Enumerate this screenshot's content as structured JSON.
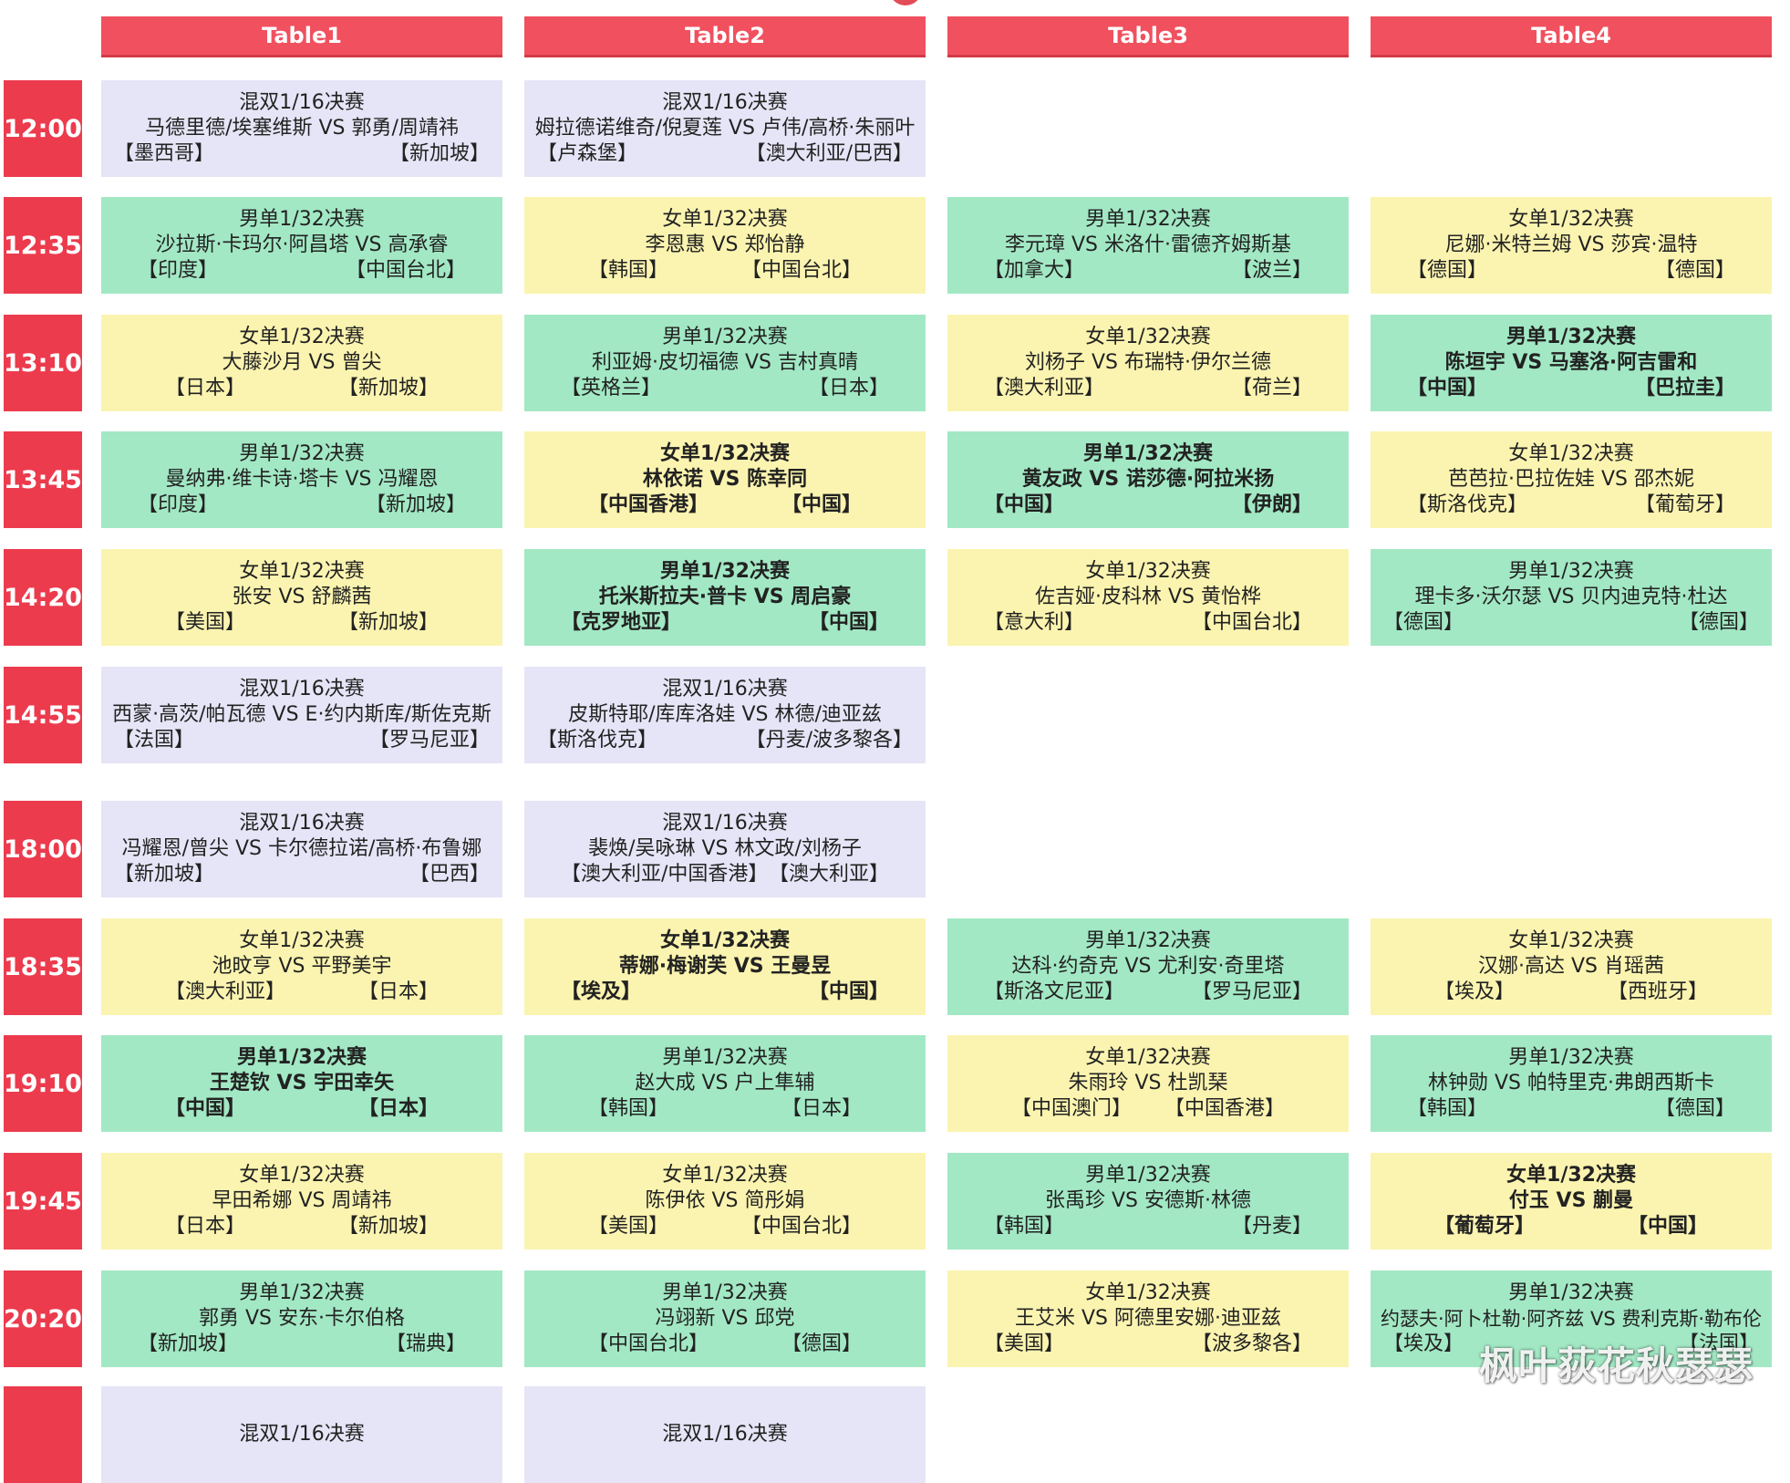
{
  "tables": [
    "Table1",
    "Table2",
    "Table3",
    "Table4"
  ],
  "rows": [
    {
      "time": "12:00",
      "cells": [
        {
          "type": "mx",
          "bold": false,
          "event": "混双1/16决赛",
          "players": "马德里德/埃塞维斯 VS 郭勇/周靖祎",
          "c1": "【墨西哥】",
          "c2": "【新加坡】"
        },
        {
          "type": "mx",
          "bold": false,
          "event": "混双1/16决赛",
          "players": "姆拉德诺维奇/倪夏莲 VS 卢伟/高桥·朱丽叶",
          "c1": "【卢森堡】",
          "c2": "【澳大利亚/巴西】"
        },
        null,
        null
      ]
    },
    {
      "time": "12:35",
      "cells": [
        {
          "type": "ms",
          "bold": false,
          "event": "男单1/32决赛",
          "players": "沙拉斯·卡玛尔·阿昌塔 VS 高承睿",
          "c1": "【印度】",
          "c2": "【中国台北】"
        },
        {
          "type": "ws",
          "bold": false,
          "event": "女单1/32决赛",
          "players": "李恩惠 VS 郑怡静",
          "c1": "【韩国】",
          "c2": "【中国台北】"
        },
        {
          "type": "ms",
          "bold": false,
          "event": "男单1/32决赛",
          "players": "李元璋 VS 米洛什·雷德齐姆斯基",
          "c1": "【加拿大】",
          "c2": "【波兰】"
        },
        {
          "type": "ws",
          "bold": false,
          "event": "女单1/32决赛",
          "players": "尼娜·米特兰姆 VS 莎宾·温特",
          "c1": "【德国】",
          "c2": "【德国】"
        }
      ]
    },
    {
      "time": "13:10",
      "cells": [
        {
          "type": "ws",
          "bold": false,
          "event": "女单1/32决赛",
          "players": "大藤沙月 VS 曾尖",
          "c1": "【日本】",
          "c2": "【新加坡】"
        },
        {
          "type": "ms",
          "bold": false,
          "event": "男单1/32决赛",
          "players": "利亚姆·皮切福德 VS 吉村真晴",
          "c1": "【英格兰】",
          "c2": "【日本】"
        },
        {
          "type": "ws",
          "bold": false,
          "event": "女单1/32决赛",
          "players": "刘杨子 VS 布瑞特·伊尔兰德",
          "c1": "【澳大利亚】",
          "c2": "【荷兰】"
        },
        {
          "type": "ms",
          "bold": true,
          "event": "男单1/32决赛",
          "players": "陈垣宇 VS 马塞洛·阿吉雷和",
          "c1": "【中国】",
          "c2": "【巴拉圭】"
        }
      ]
    },
    {
      "time": "13:45",
      "cells": [
        {
          "type": "ms",
          "bold": false,
          "event": "男单1/32决赛",
          "players": "曼纳弗·维卡诗·塔卡 VS 冯耀恩",
          "c1": "【印度】",
          "c2": "【新加坡】"
        },
        {
          "type": "ws",
          "bold": true,
          "event": "女单1/32决赛",
          "players": "林依诺 VS 陈幸同",
          "c1": "【中国香港】",
          "c2": "【中国】"
        },
        {
          "type": "ms",
          "bold": true,
          "event": "男单1/32决赛",
          "players": "黄友政 VS 诺莎德·阿拉米扬",
          "c1": "【中国】",
          "c2": "【伊朗】"
        },
        {
          "type": "ws",
          "bold": false,
          "event": "女单1/32决赛",
          "players": "芭芭拉·巴拉佐娃 VS 邵杰妮",
          "c1": "【斯洛伐克】",
          "c2": "【葡萄牙】"
        }
      ]
    },
    {
      "time": "14:20",
      "cells": [
        {
          "type": "ws",
          "bold": false,
          "event": "女单1/32决赛",
          "players": "张安 VS 舒麟茜",
          "c1": "【美国】",
          "c2": "【新加坡】"
        },
        {
          "type": "ms",
          "bold": true,
          "event": "男单1/32决赛",
          "players": "托米斯拉夫·普卡 VS 周启豪",
          "c1": "【克罗地亚】",
          "c2": "【中国】"
        },
        {
          "type": "ws",
          "bold": false,
          "event": "女单1/32决赛",
          "players": "佐吉娅·皮科林 VS 黄怡桦",
          "c1": "【意大利】",
          "c2": "【中国台北】"
        },
        {
          "type": "ms",
          "bold": false,
          "event": "男单1/32决赛",
          "players": "理卡多·沃尔瑟 VS 贝内迪克特·杜达",
          "c1": "【德国】",
          "c2": "【德国】"
        }
      ]
    },
    {
      "time": "14:55",
      "cells": [
        {
          "type": "mx",
          "bold": false,
          "event": "混双1/16决赛",
          "players": "西蒙·高茨/帕瓦德 VS E·约内斯库/斯佐克斯",
          "c1": "【法国】",
          "c2": "【罗马尼亚】"
        },
        {
          "type": "mx",
          "bold": false,
          "event": "混双1/16决赛",
          "players": "皮斯特耶/库库洛娃 VS 林德/迪亚兹",
          "c1": "【斯洛伐克】",
          "c2": "【丹麦/波多黎各】"
        },
        null,
        null
      ]
    },
    {
      "time": "18:00",
      "cells": [
        {
          "type": "mx",
          "bold": false,
          "event": "混双1/16决赛",
          "players": "冯耀恩/曾尖 VS 卡尔德拉诺/高桥·布鲁娜",
          "c1": "【新加坡】",
          "c2": "【巴西】"
        },
        {
          "type": "mx",
          "bold": false,
          "event": "混双1/16决赛",
          "players": "裴焕/吴咏琳 VS 林文政/刘杨子",
          "c1": "【澳大利亚/中国香港】",
          "c2": "【澳大利亚】"
        },
        null,
        null
      ]
    },
    {
      "time": "18:35",
      "cells": [
        {
          "type": "ws",
          "bold": false,
          "event": "女单1/32决赛",
          "players": "池旼亨 VS 平野美宇",
          "c1": "【澳大利亚】",
          "c2": "【日本】"
        },
        {
          "type": "ws",
          "bold": true,
          "event": "女单1/32决赛",
          "players": "蒂娜·梅谢芙 VS 王曼昱",
          "c1": "【埃及】",
          "c2": "【中国】"
        },
        {
          "type": "ms",
          "bold": false,
          "event": "男单1/32决赛",
          "players": "达科·约奇克 VS 尤利安·奇里塔",
          "c1": "【斯洛文尼亚】",
          "c2": "【罗马尼亚】"
        },
        {
          "type": "ws",
          "bold": false,
          "event": "女单1/32决赛",
          "players": "汉娜·高达 VS 肖瑶茜",
          "c1": "【埃及】",
          "c2": "【西班牙】"
        }
      ]
    },
    {
      "time": "19:10",
      "cells": [
        {
          "type": "ms",
          "bold": true,
          "event": "男单1/32决赛",
          "players": "王楚钦 VS 宇田幸矢",
          "c1": "【中国】",
          "c2": "【日本】"
        },
        {
          "type": "ms",
          "bold": false,
          "event": "男单1/32决赛",
          "players": "赵大成 VS 户上隼辅",
          "c1": "【韩国】",
          "c2": "【日本】"
        },
        {
          "type": "ws",
          "bold": false,
          "event": "女单1/32决赛",
          "players": "朱雨玲 VS 杜凯琹",
          "c1": "【中国澳门】",
          "c2": "【中国香港】"
        },
        {
          "type": "ms",
          "bold": false,
          "event": "男单1/32决赛",
          "players": "林钟勋 VS 帕特里克·弗朗西斯卡",
          "c1": "【韩国】",
          "c2": "【德国】"
        }
      ]
    },
    {
      "time": "19:45",
      "cells": [
        {
          "type": "ws",
          "bold": false,
          "event": "女单1/32决赛",
          "players": "早田希娜 VS 周靖祎",
          "c1": "【日本】",
          "c2": "【新加坡】"
        },
        {
          "type": "ws",
          "bold": false,
          "event": "女单1/32决赛",
          "players": "陈伊依 VS 简彤娟",
          "c1": "【美国】",
          "c2": "【中国台北】"
        },
        {
          "type": "ms",
          "bold": false,
          "event": "男单1/32决赛",
          "players": "张禹珍 VS 安德斯·林德",
          "c1": "【韩国】",
          "c2": "【丹麦】"
        },
        {
          "type": "ws",
          "bold": true,
          "event": "女单1/32决赛",
          "players": "付玉 VS 蒯曼",
          "c1": "【葡萄牙】",
          "c2": "【中国】"
        }
      ]
    },
    {
      "time": "20:20",
      "cells": [
        {
          "type": "ms",
          "bold": false,
          "event": "男单1/32决赛",
          "players": "郭勇 VS 安东·卡尔伯格",
          "c1": "【新加坡】",
          "c2": "【瑞典】"
        },
        {
          "type": "ms",
          "bold": false,
          "event": "男单1/32决赛",
          "players": "冯翊新 VS 邱党",
          "c1": "【中国台北】",
          "c2": "【德国】"
        },
        {
          "type": "ws",
          "bold": false,
          "event": "女单1/32决赛",
          "players": "王艾米 VS 阿德里安娜·迪亚兹",
          "c1": "【美国】",
          "c2": "【波多黎各】"
        },
        {
          "type": "ms",
          "bold": false,
          "event": "男单1/32决赛",
          "players": "约瑟夫·阿卜杜勒·阿齐兹 VS 费利克斯·勒布伦",
          "c1": "【埃及】",
          "c2": "【法国】"
        }
      ]
    },
    {
      "time": "",
      "cells": [
        {
          "type": "mx",
          "bold": false,
          "event": "混双1/16决赛",
          "players": "",
          "c1": "",
          "c2": ""
        },
        {
          "type": "mx",
          "bold": false,
          "event": "混双1/16决赛",
          "players": "",
          "c1": "",
          "c2": ""
        },
        null,
        null
      ]
    }
  ],
  "watermark": "枫叶荻花秋瑟瑟",
  "colors": {
    "header": "#f1505e",
    "time": "#ec3b4d",
    "mixed_doubles": "#e6e5f7",
    "mens_singles": "#a2e8c4",
    "womens_singles": "#fbf4b0"
  }
}
